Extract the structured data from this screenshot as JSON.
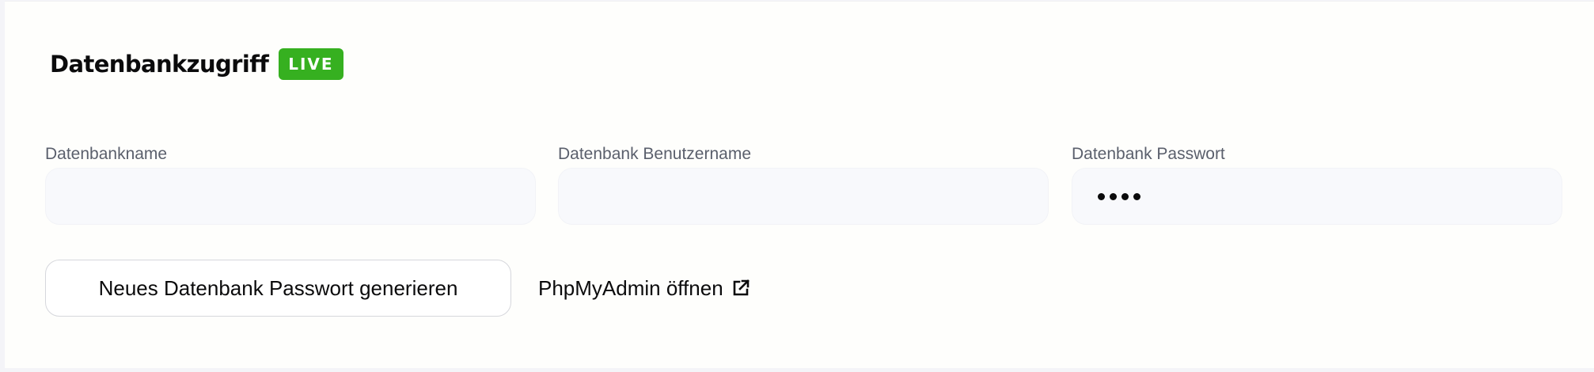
{
  "section": {
    "title": "Datenbankzugriff",
    "badge": "LIVE"
  },
  "fields": {
    "db_name": {
      "label": "Datenbankname",
      "value": ""
    },
    "db_user": {
      "label": "Datenbank Benutzername",
      "value": ""
    },
    "db_password": {
      "label": "Datenbank Passwort",
      "masked_length": 4
    }
  },
  "actions": {
    "generate_password_label": "Neues Datenbank Passwort generieren",
    "phpmyadmin_label": "PhpMyAdmin öffnen",
    "phpmyadmin_icon": "external-link-icon"
  },
  "colors": {
    "badge_bg": "#36b020",
    "input_bg": "#f8f9fc",
    "label_text": "#5a5f6c"
  }
}
